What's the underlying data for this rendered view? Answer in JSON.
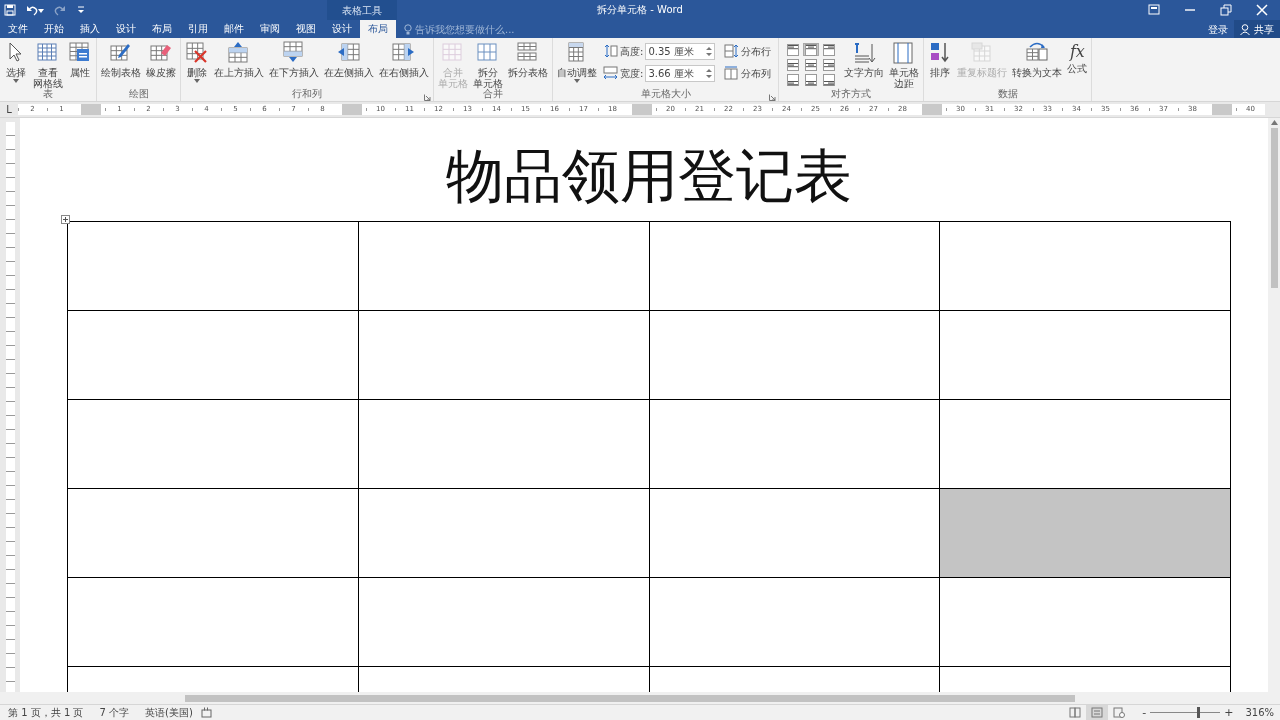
{
  "window": {
    "title": "拆分单元格 - Word",
    "context_label": "表格工具"
  },
  "quick_access": [
    {
      "disabled": false,
      "dropdown": false
    },
    {
      "disabled": false,
      "dropdown": true
    },
    {
      "disabled": true,
      "dropdown": false
    },
    {
      "disabled": false,
      "dropdown": false
    }
  ],
  "tabs": [
    {
      "label": "文件",
      "selected": false
    },
    {
      "label": "开始",
      "selected": false
    },
    {
      "label": "插入",
      "selected": false
    },
    {
      "label": "设计",
      "selected": false
    },
    {
      "label": "布局",
      "selected": false
    },
    {
      "label": "引用",
      "selected": false
    },
    {
      "label": "邮件",
      "selected": false
    },
    {
      "label": "审阅",
      "selected": false
    },
    {
      "label": "视图",
      "selected": false
    },
    {
      "label": "设计",
      "selected": false
    },
    {
      "label": "布局",
      "selected": true
    }
  ],
  "tell_me": {
    "placeholder": "告诉我您想要做什么..."
  },
  "account": {
    "sign_in": "登录",
    "share": "共享"
  },
  "ribbon": [
    {
      "label": "表",
      "launcher": false,
      "items": [
        {
          "kind": "button",
          "label": [
            "选择"
          ],
          "dropdown": true,
          "disabled": false
        },
        {
          "kind": "button",
          "label": [
            "查看",
            "网格线"
          ],
          "dropdown": false,
          "disabled": false
        },
        {
          "kind": "button",
          "label": [
            "属性"
          ],
          "dropdown": false,
          "disabled": false
        }
      ]
    },
    {
      "label": "绘图",
      "launcher": false,
      "items": [
        {
          "kind": "button",
          "label": [
            "绘制表格"
          ],
          "dropdown": false,
          "disabled": false
        },
        {
          "kind": "button",
          "label": [
            "橡皮擦"
          ],
          "dropdown": false,
          "disabled": false
        }
      ]
    },
    {
      "label": "行和列",
      "launcher": true,
      "items": [
        {
          "kind": "button",
          "label": [
            "删除"
          ],
          "dropdown": true,
          "disabled": false
        },
        {
          "kind": "button",
          "label": [
            "在上方插入"
          ],
          "dropdown": false,
          "disabled": false
        },
        {
          "kind": "button",
          "label": [
            "在下方插入"
          ],
          "dropdown": false,
          "disabled": false
        },
        {
          "kind": "button",
          "label": [
            "在左侧插入"
          ],
          "dropdown": false,
          "disabled": false
        },
        {
          "kind": "button",
          "label": [
            "在右侧插入"
          ],
          "dropdown": false,
          "disabled": false
        }
      ]
    },
    {
      "label": "合并",
      "launcher": false,
      "items": [
        {
          "kind": "button",
          "label": [
            "合并",
            "单元格"
          ],
          "dropdown": false,
          "disabled": true
        },
        {
          "kind": "button",
          "label": [
            "拆分",
            "单元格"
          ],
          "dropdown": false,
          "disabled": false
        },
        {
          "kind": "button",
          "label": [
            "拆分表格"
          ],
          "dropdown": false,
          "disabled": false
        }
      ]
    },
    {
      "label": "单元格大小",
      "launcher": true,
      "items": [
        {
          "kind": "button",
          "label": [
            "自动调整"
          ],
          "dropdown": true,
          "disabled": false
        },
        {
          "kind": "fields",
          "fields": [
            {
              "label": "高度:",
              "value": "0.35 厘米"
            },
            {
              "label": "宽度:",
              "value": "3.66 厘米"
            }
          ]
        },
        {
          "kind": "smallbuttons",
          "buttons": [
            {
              "label": "分布行"
            },
            {
              "label": "分布列"
            }
          ]
        }
      ]
    },
    {
      "label": "对齐方式",
      "launcher": false,
      "items": [
        {
          "kind": "aligngrid",
          "cells": [
            {
              "selected": false
            },
            {
              "selected": true
            },
            {
              "selected": false
            },
            {
              "selected": false
            },
            {
              "selected": false
            },
            {
              "selected": false
            },
            {
              "selected": false
            },
            {
              "selected": false
            },
            {
              "selected": false
            }
          ]
        },
        {
          "kind": "button",
          "label": [
            "文字方向"
          ],
          "dropdown": false,
          "disabled": false
        },
        {
          "kind": "button",
          "label": [
            "单元格",
            "边距"
          ],
          "dropdown": false,
          "disabled": false
        }
      ]
    },
    {
      "label": "数据",
      "launcher": false,
      "items": [
        {
          "kind": "button",
          "label": [
            "排序"
          ],
          "dropdown": false,
          "disabled": false
        },
        {
          "kind": "button",
          "label": [
            "重复标题行"
          ],
          "dropdown": false,
          "disabled": true
        },
        {
          "kind": "button",
          "label": [
            "转换为文本"
          ],
          "dropdown": false,
          "disabled": false
        },
        {
          "kind": "button",
          "label": [
            "公式"
          ],
          "dropdown": false,
          "disabled": false,
          "icon_text": "fx"
        }
      ]
    }
  ],
  "ruler": {
    "tab_selector": "L",
    "items": [
      {
        "kind": "number",
        "text": "2"
      },
      {
        "kind": "number",
        "text": "1"
      },
      {
        "kind": "marker"
      },
      {
        "kind": "number",
        "text": "1"
      },
      {
        "kind": "number",
        "text": "2"
      },
      {
        "kind": "number",
        "text": "3"
      },
      {
        "kind": "number",
        "text": "4"
      },
      {
        "kind": "number",
        "text": "5"
      },
      {
        "kind": "number",
        "text": "6"
      },
      {
        "kind": "number",
        "text": "7"
      },
      {
        "kind": "number",
        "text": "8"
      },
      {
        "kind": "marker"
      },
      {
        "kind": "number",
        "text": "10"
      },
      {
        "kind": "number",
        "text": "11"
      },
      {
        "kind": "number",
        "text": "12"
      },
      {
        "kind": "number",
        "text": "13"
      },
      {
        "kind": "number",
        "text": "14"
      },
      {
        "kind": "number",
        "text": "15"
      },
      {
        "kind": "number",
        "text": "16"
      },
      {
        "kind": "number",
        "text": "17"
      },
      {
        "kind": "number",
        "text": "18"
      },
      {
        "kind": "marker"
      },
      {
        "kind": "number",
        "text": "20"
      },
      {
        "kind": "number",
        "text": "21"
      },
      {
        "kind": "number",
        "text": "22"
      },
      {
        "kind": "number",
        "text": "23"
      },
      {
        "kind": "number",
        "text": "24"
      },
      {
        "kind": "number",
        "text": "25"
      },
      {
        "kind": "number",
        "text": "26"
      },
      {
        "kind": "number",
        "text": "27"
      },
      {
        "kind": "number",
        "text": "28"
      },
      {
        "kind": "marker"
      },
      {
        "kind": "number",
        "text": "30"
      },
      {
        "kind": "number",
        "text": "31"
      },
      {
        "kind": "number",
        "text": "32"
      },
      {
        "kind": "number",
        "text": "33"
      },
      {
        "kind": "number",
        "text": "34"
      },
      {
        "kind": "number",
        "text": "35"
      },
      {
        "kind": "number",
        "text": "36"
      },
      {
        "kind": "number",
        "text": "37"
      },
      {
        "kind": "number",
        "text": "38"
      },
      {
        "kind": "marker"
      },
      {
        "kind": "number",
        "text": "40"
      }
    ]
  },
  "document": {
    "heading": "物品领用登记表",
    "table": {
      "rows": [
        {
          "cells": [
            {
              "selected": false
            },
            {
              "selected": false
            },
            {
              "selected": false
            },
            {
              "selected": false
            }
          ]
        },
        {
          "cells": [
            {
              "selected": false
            },
            {
              "selected": false
            },
            {
              "selected": false
            },
            {
              "selected": false
            }
          ]
        },
        {
          "cells": [
            {
              "selected": false
            },
            {
              "selected": false
            },
            {
              "selected": false
            },
            {
              "selected": false
            }
          ]
        },
        {
          "cells": [
            {
              "selected": false
            },
            {
              "selected": false
            },
            {
              "selected": false
            },
            {
              "selected": true
            }
          ]
        },
        {
          "cells": [
            {
              "selected": false
            },
            {
              "selected": false
            },
            {
              "selected": false
            },
            {
              "selected": false
            }
          ]
        },
        {
          "cells": [
            {
              "selected": false
            },
            {
              "selected": false
            },
            {
              "selected": false
            },
            {
              "selected": false
            }
          ]
        }
      ]
    }
  },
  "status_bar": {
    "items": [
      "第 1 页，共 1 页",
      "7 个字",
      "英语(美国)"
    ],
    "views": [
      {
        "selected": false
      },
      {
        "selected": true
      },
      {
        "selected": false
      }
    ],
    "zoom": {
      "out": "-",
      "in": "+",
      "level": 0.69,
      "reading": "316%"
    }
  }
}
